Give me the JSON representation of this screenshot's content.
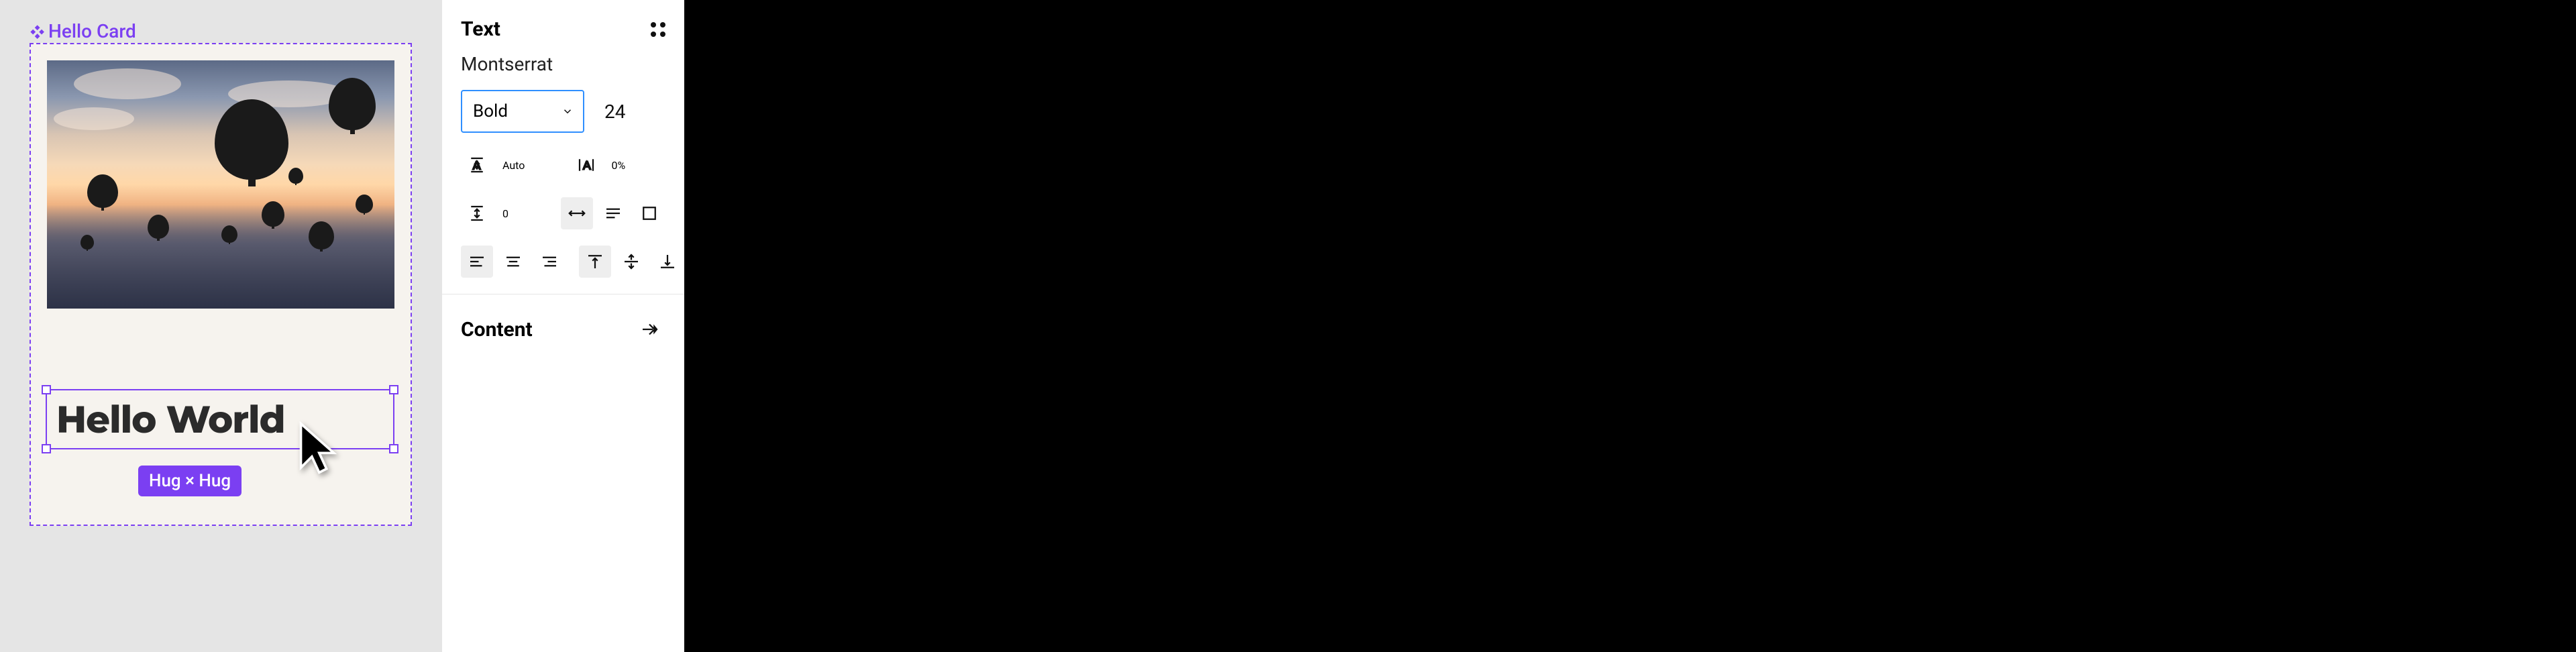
{
  "canvas": {
    "component_label": "Hello Card",
    "text_content": "Hello World",
    "size_badge": "Hug × Hug"
  },
  "inspector": {
    "text_section": {
      "title": "Text",
      "font_family": "Montserrat",
      "font_weight": "Bold",
      "font_size": "24",
      "line_height": "Auto",
      "letter_spacing": "0%",
      "paragraph_spacing": "0",
      "resize_mode": "auto-width",
      "horizontal_align": "left",
      "vertical_align": "top"
    },
    "content_section": {
      "title": "Content"
    }
  },
  "icons": {
    "component": "component-icon",
    "chevron_down": "chevron-down-icon",
    "line_height": "line-height-icon",
    "letter_spacing": "letter-spacing-icon",
    "paragraph_spacing": "paragraph-spacing-icon",
    "auto_width": "auto-width-icon",
    "auto_height": "auto-height-icon",
    "fixed_size": "fixed-size-icon",
    "align_left": "align-left-icon",
    "align_center": "align-center-icon",
    "align_right": "align-right-icon",
    "align_top": "align-top-icon",
    "align_middle": "align-middle-icon",
    "align_bottom": "align-bottom-icon",
    "more": "more-icon",
    "apply_content": "apply-content-icon",
    "drag_handle": "drag-handle-icon"
  }
}
